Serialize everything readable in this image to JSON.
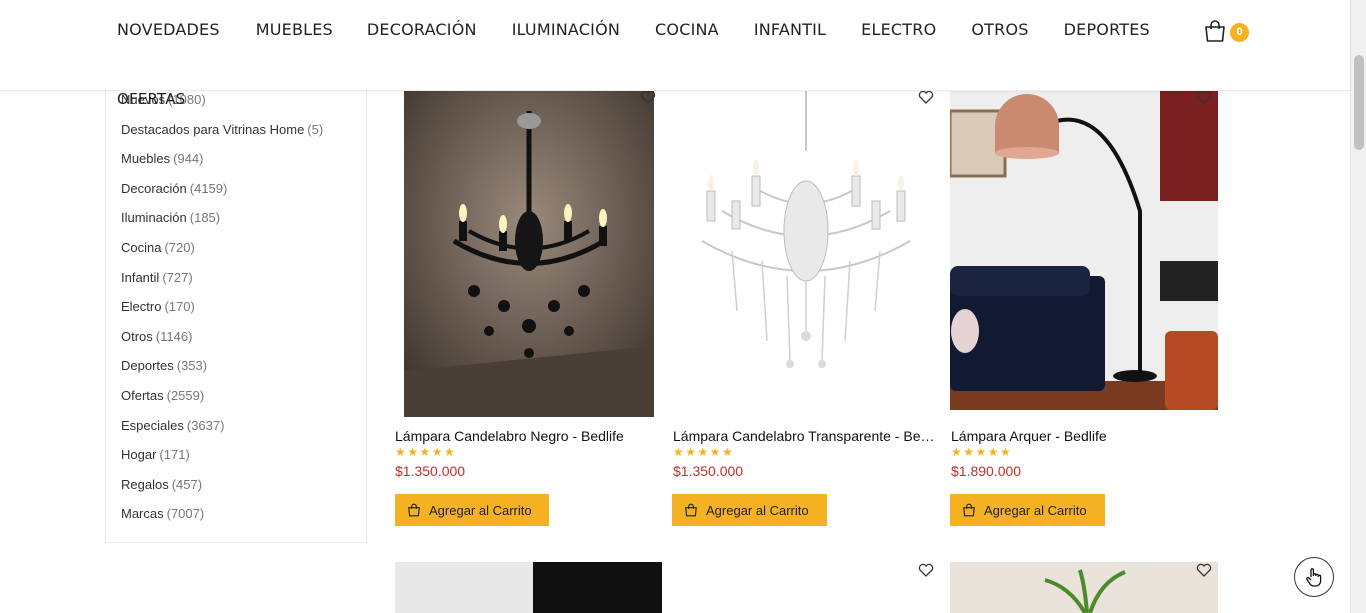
{
  "nav": {
    "items": [
      "NOVEDADES",
      "MUEBLES",
      "DECORACIÓN",
      "ILUMINACIÓN",
      "COCINA",
      "INFANTIL",
      "ELECTRO",
      "OTROS",
      "DEPORTES"
    ],
    "overflow_item": "OFERTAS",
    "cart_count": "0"
  },
  "sidebar": {
    "categories": [
      {
        "label": "Nuevos",
        "count": "(1080)"
      },
      {
        "label": "Destacados para Vitrinas Home",
        "count": "(5)"
      },
      {
        "label": "Muebles",
        "count": "(944)"
      },
      {
        "label": "Decoración",
        "count": "(4159)"
      },
      {
        "label": "Iluminación",
        "count": "(185)"
      },
      {
        "label": "Cocina",
        "count": "(720)"
      },
      {
        "label": "Infantil",
        "count": "(727)"
      },
      {
        "label": "Electro",
        "count": "(170)"
      },
      {
        "label": "Otros",
        "count": "(1146)"
      },
      {
        "label": "Deportes",
        "count": "(353)"
      },
      {
        "label": "Ofertas",
        "count": "(2559)"
      },
      {
        "label": "Especiales",
        "count": "(3637)"
      },
      {
        "label": "Hogar",
        "count": "(171)"
      },
      {
        "label": "Regalos",
        "count": "(457)"
      },
      {
        "label": "Marcas",
        "count": "(7007)"
      }
    ]
  },
  "products": [
    {
      "name": "Lámpara Candelabro Negro - Bedlife",
      "price": "$1.350.000",
      "stars": "★★★★★",
      "rating": 5,
      "button": "Agregar al Carrito",
      "icon": "black-chandelier-image"
    },
    {
      "name": "Lámpara Candelabro Transparente - Bedlife",
      "price": "$1.350.000",
      "stars": "★★★★★",
      "rating": 5,
      "button": "Agregar al Carrito",
      "icon": "crystal-chandelier-image"
    },
    {
      "name": "Lámpara Arquer - Bedlife",
      "price": "$1.890.000",
      "stars": "★★★★★",
      "rating": 5,
      "button": "Agregar al Carrito",
      "icon": "arc-lamp-image"
    }
  ],
  "colors": {
    "accent": "#f4b223",
    "price": "#c0302a"
  }
}
